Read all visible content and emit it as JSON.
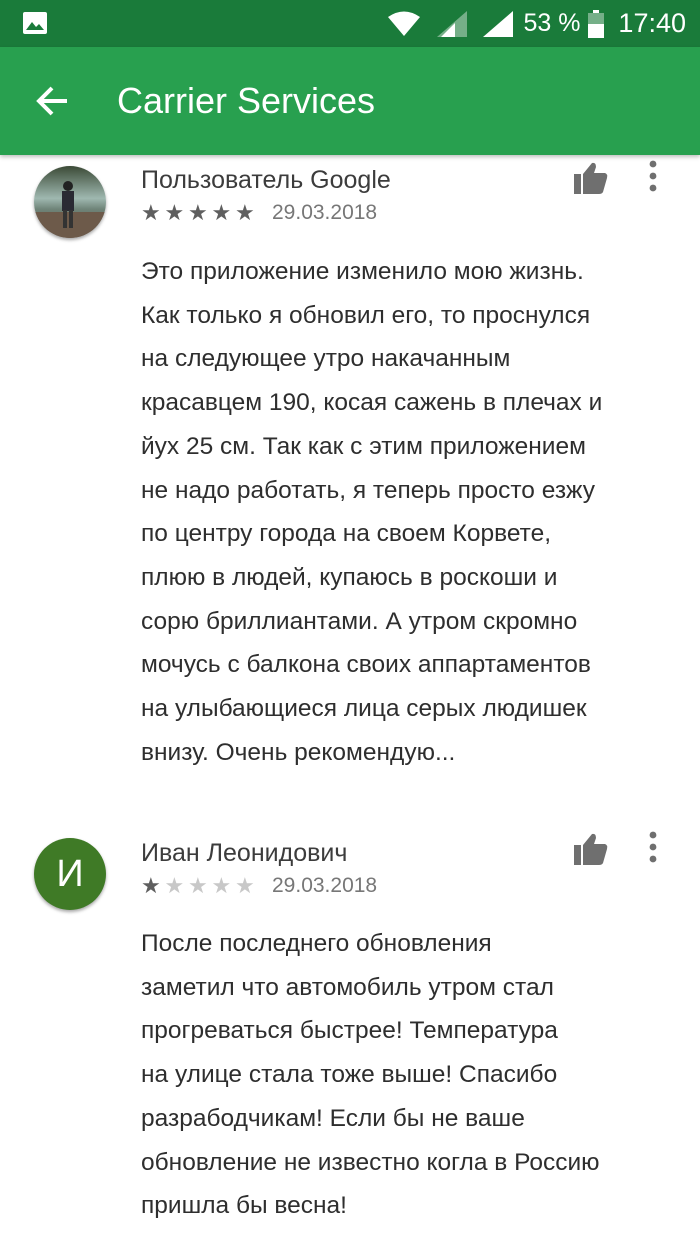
{
  "status_bar": {
    "battery": "53 %",
    "time": "17:40",
    "icons": [
      "image-notification-icon",
      "wifi-icon",
      "signal-icon",
      "signal-icon",
      "battery-icon"
    ]
  },
  "app_bar": {
    "title": "Carrier Services",
    "back_icon": "arrow-back-icon",
    "color": "#28a04f",
    "status_color": "#1a7b3a"
  },
  "reviews": [
    {
      "author": "Пользователь Google",
      "rating": 5,
      "max_rating": 5,
      "date": "29.03.2018",
      "avatar": "photo",
      "lines": [
        "Это приложение изменило мою жизнь.",
        "Как только я обновил его, то проснулся",
        "на следующее утро накачанным",
        "красавцем 190, косая сажень в плечах и",
        "йух 25 см. Так как с этим приложением",
        "не надо работать, я теперь просто езжу",
        "по центру города на своем Корвете,",
        "плюю в людей, купаюсь в роскоши и",
        "сорю бриллиантами. А утром скромно",
        "мочусь с балкона своих аппартаментов",
        "на улыбающиеся лица серых людишек",
        "внизу. Очень рекомендую..."
      ]
    },
    {
      "author": "Иван Леонидович",
      "rating": 1,
      "max_rating": 5,
      "date": "29.03.2018",
      "avatar_letter": "И",
      "avatar_color": "#3f7a26",
      "lines": [
        "После последнего обновления",
        "заметил что автомобиль утром стал",
        "прогреваться быстрее! Температура",
        "на улице стала тоже выше! Спасибо",
        "разрабодчикам! Если бы не ваше",
        "обновление не известно когла в Россию",
        "пришла бы весна!"
      ]
    }
  ]
}
